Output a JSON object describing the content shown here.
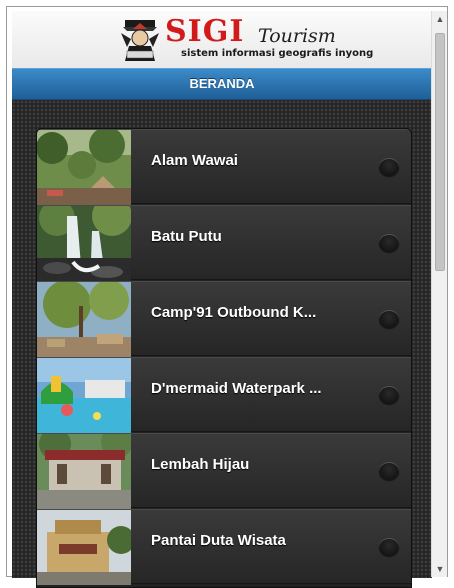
{
  "header": {
    "logo_title": "SIGI",
    "logo_script": "Tourism",
    "logo_tagline": "sistem informasi geografis inyong"
  },
  "navbar": {
    "title": "BERANDA"
  },
  "list": {
    "items": [
      {
        "label": "Alam Wawai"
      },
      {
        "label": "Batu Putu"
      },
      {
        "label": "Camp'91 Outbound K..."
      },
      {
        "label": "D'mermaid Waterpark ..."
      },
      {
        "label": "Lembah Hijau"
      },
      {
        "label": "Pantai Duta Wisata"
      }
    ]
  },
  "colors": {
    "brand_red": "#d21a1a",
    "navbar_blue": "#1f5f98",
    "list_bg": "#2f2f2f"
  }
}
